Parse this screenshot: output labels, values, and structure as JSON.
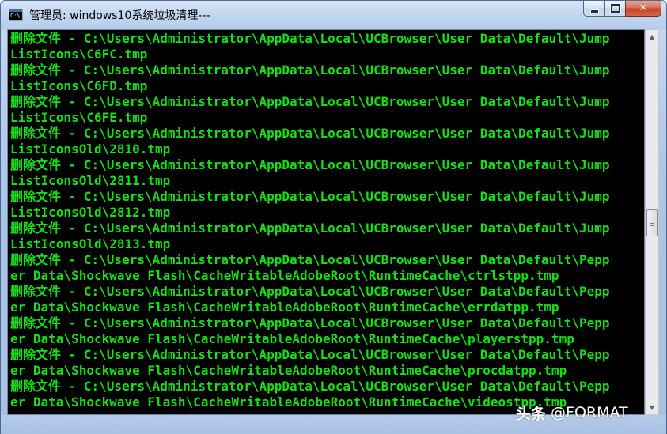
{
  "window": {
    "title": "管理员: windows10系统垃圾清理---",
    "icon": "cmd-icon",
    "icon_text": "C:\\",
    "caption": {
      "minimize": "minimize-icon",
      "maximize": "maximize-icon",
      "close_glyph": "✕"
    }
  },
  "console": {
    "text_color": "#13e113",
    "background": "#000000",
    "lines": [
      "删除文件 - C:\\Users\\Administrator\\AppData\\Local\\UCBrowser\\User Data\\Default\\Jump",
      "ListIcons\\C6FC.tmp",
      "删除文件 - C:\\Users\\Administrator\\AppData\\Local\\UCBrowser\\User Data\\Default\\Jump",
      "ListIcons\\C6FD.tmp",
      "删除文件 - C:\\Users\\Administrator\\AppData\\Local\\UCBrowser\\User Data\\Default\\Jump",
      "ListIcons\\C6FE.tmp",
      "删除文件 - C:\\Users\\Administrator\\AppData\\Local\\UCBrowser\\User Data\\Default\\Jump",
      "ListIconsOld\\2810.tmp",
      "删除文件 - C:\\Users\\Administrator\\AppData\\Local\\UCBrowser\\User Data\\Default\\Jump",
      "ListIconsOld\\2811.tmp",
      "删除文件 - C:\\Users\\Administrator\\AppData\\Local\\UCBrowser\\User Data\\Default\\Jump",
      "ListIconsOld\\2812.tmp",
      "删除文件 - C:\\Users\\Administrator\\AppData\\Local\\UCBrowser\\User Data\\Default\\Jump",
      "ListIconsOld\\2813.tmp",
      "删除文件 - C:\\Users\\Administrator\\AppData\\Local\\UCBrowser\\User Data\\Default\\Pepp",
      "er Data\\Shockwave Flash\\CacheWritableAdobeRoot\\RuntimeCache\\ctrlstpp.tmp",
      "删除文件 - C:\\Users\\Administrator\\AppData\\Local\\UCBrowser\\User Data\\Default\\Pepp",
      "er Data\\Shockwave Flash\\CacheWritableAdobeRoot\\RuntimeCache\\errdatpp.tmp",
      "删除文件 - C:\\Users\\Administrator\\AppData\\Local\\UCBrowser\\User Data\\Default\\Pepp",
      "er Data\\Shockwave Flash\\CacheWritableAdobeRoot\\RuntimeCache\\playerstpp.tmp",
      "删除文件 - C:\\Users\\Administrator\\AppData\\Local\\UCBrowser\\User Data\\Default\\Pepp",
      "er Data\\Shockwave Flash\\CacheWritableAdobeRoot\\RuntimeCache\\procdatpp.tmp",
      "删除文件 - C:\\Users\\Administrator\\AppData\\Local\\UCBrowser\\User Data\\Default\\Pepp",
      "er Data\\Shockwave Flash\\CacheWritableAdobeRoot\\RuntimeCache\\videostpp.tmp"
    ]
  },
  "scrollbar": {
    "up_arrow": "▲",
    "down_arrow": "▼",
    "position": 0.5
  },
  "watermark": {
    "logo": "头条",
    "text": "@FORMAT"
  }
}
